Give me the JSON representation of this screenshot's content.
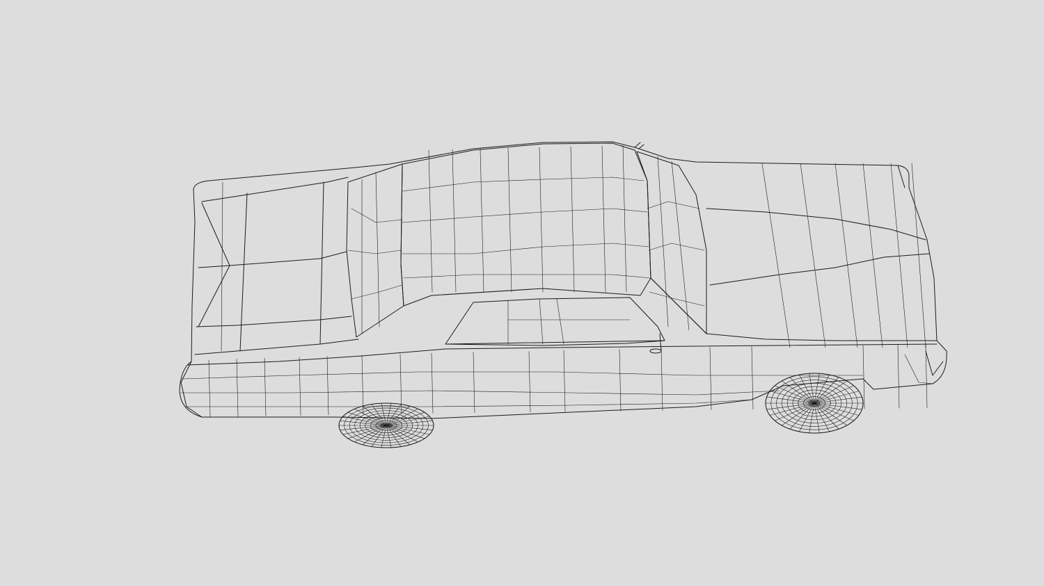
{
  "viewport": {
    "background_color": "#dddddd",
    "render_mode": "wireframe",
    "model": "car",
    "model_fill_color": "#dce1e1",
    "wire_color": "#1a1a1a"
  }
}
